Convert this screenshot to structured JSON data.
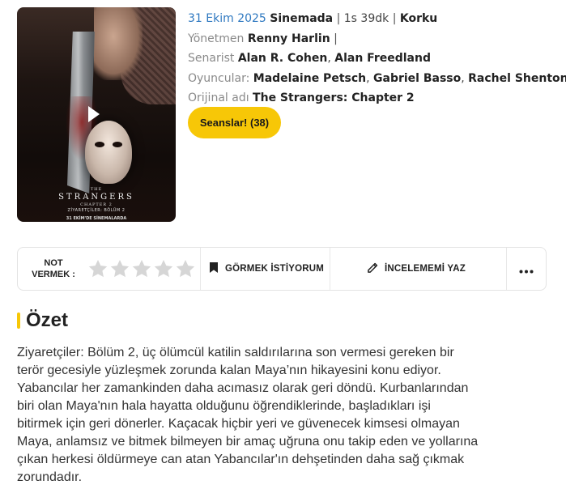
{
  "poster": {
    "title_small": "THE",
    "title_main": "STRANGERS",
    "title_chapter": "CHAPTER 2",
    "subtitle": "ZİYARETÇİLER: BÖLÜM 2",
    "release_note": "31 EKİM'DE SİNEMALARDA",
    "play_icon": "play-icon"
  },
  "info": {
    "release_date": "31 Ekim 2025",
    "release_where": "Sinemada",
    "duration": "1s 39dk",
    "genre": "Korku",
    "director_label": "Yönetmen",
    "director": "Renny Harlin",
    "writer_label": "Senarist",
    "writers": [
      "Alan R. Cohen",
      "Alan Freedland"
    ],
    "cast_label": "Oyuncular:",
    "cast": [
      "Madelaine Petsch",
      "Gabriel Basso",
      "Rachel Shenton"
    ],
    "original_title_label": "Orijinal adı",
    "original_title": "The Strangers: Chapter 2",
    "separator": "|",
    "comma": ","
  },
  "seans_button": "Seanslar! (38)",
  "action_bar": {
    "rate_label_line1": "NOT",
    "rate_label_line2": "VERMEK :",
    "star_count": 5,
    "rating": 0,
    "watch_label": "GÖRMEK İSTİYORUM",
    "review_label": "İNCELEMEMİ YAZ",
    "more_icon": "more-dots-icon"
  },
  "summary": {
    "title": "Özet",
    "lines": [
      "Ziyaretçiler: Bölüm 2, üç ölümcül katilin saldırılarına son vermesi gereken bir",
      "terör gecesiyle yüzleşmek zorunda kalan Maya’nın hikayesini konu ediyor.",
      "Yabancılar her zamankinden daha acımasız olarak geri döndü. Kurbanlarından",
      "biri olan Maya'nın hala hayatta olduğunu öğrendiklerinde, başladıkları işi",
      "bitirmek için geri dönerler. Kaçacak hiçbir yeri ve güvenecek kimsesi olmayan",
      "Maya, anlamsız ve bitmek bilmeyen bir amaç uğruna onu takip eden ve yollarına",
      "çıkan herkesi öldürmeye can atan Yabancılar'ın dehşetinden daha sağ çıkmak",
      "zorundadır."
    ]
  },
  "colors": {
    "accent_yellow": "#f7c707",
    "link_blue": "#2e78c0",
    "star_empty": "#d6d6d6"
  }
}
